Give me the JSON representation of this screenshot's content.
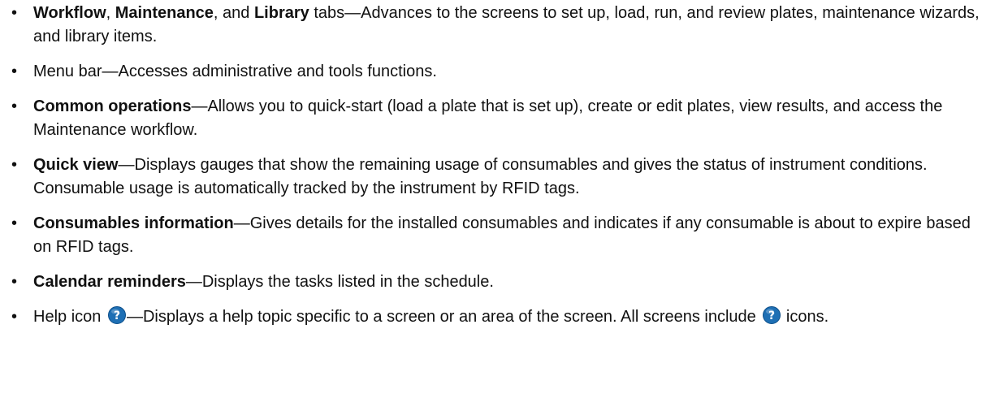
{
  "help_icon_color": "#1e6fb4",
  "items": [
    {
      "term1": "Workflow",
      "sep1": ", ",
      "term2": "Maintenance",
      "sep2": ", and ",
      "term3": "Library",
      "text": " tabs—Advances to the screens to set up, load, run, and review plates, maintenance wizards, and library items."
    },
    {
      "text": "Menu bar—Accesses administrative and tools functions."
    },
    {
      "term": "Common operations",
      "text": "—Allows you to quick-start (load a plate that is set up), create or edit plates, view results, and access the Maintenance workflow."
    },
    {
      "term": "Quick view",
      "text": "—Displays gauges that show the remaining usage of consumables and gives the status of instrument conditions. Consumable usage is automatically tracked by the instrument by RFID tags."
    },
    {
      "term": "Consumables information",
      "text": "—Gives details for the installed consumables and indicates if any consumable is about to expire based on RFID tags."
    },
    {
      "term": "Calendar reminders",
      "text": "—Displays the tasks listed in the schedule."
    },
    {
      "text_before_icon": "Help icon ",
      "text_after_icon": "—Displays a help topic specific to a screen or an area of the screen. All screens include ",
      "text_end": " icons."
    }
  ]
}
